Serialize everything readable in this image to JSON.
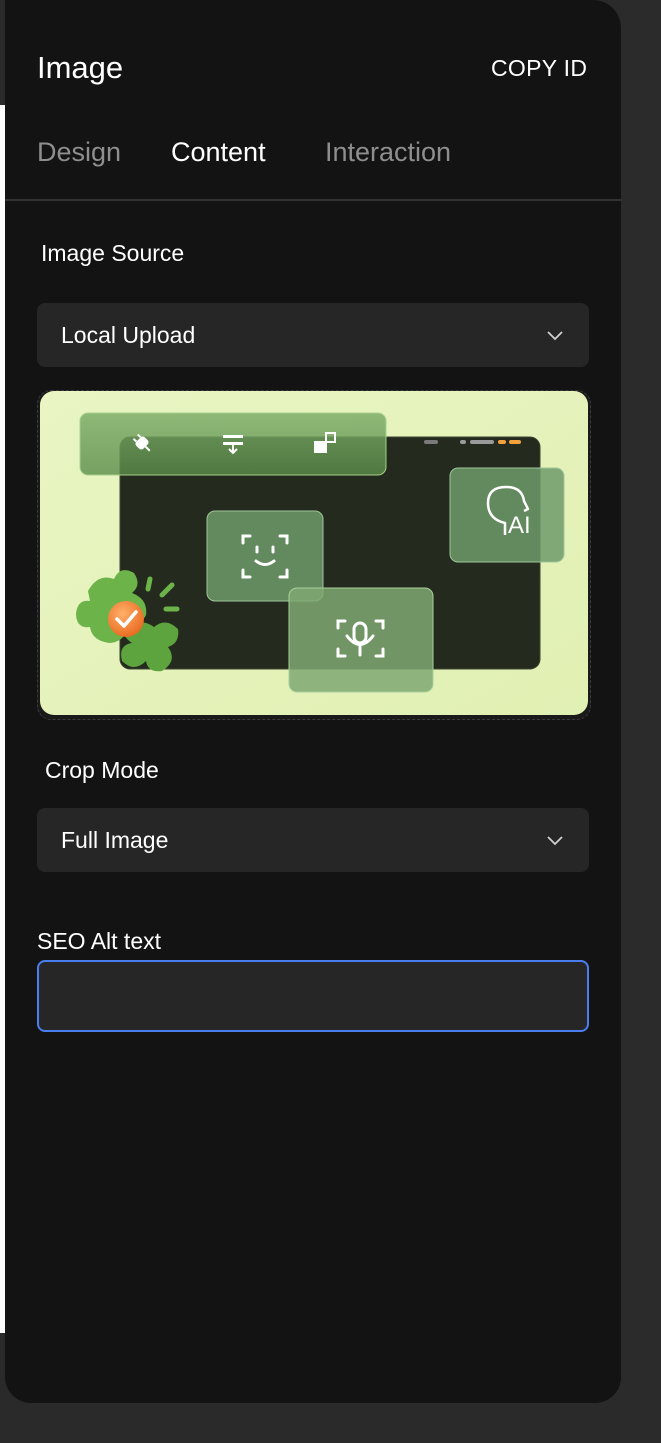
{
  "panel": {
    "title": "Image",
    "copy_id_label": "COPY ID"
  },
  "tabs": [
    {
      "label": "Design",
      "active": false
    },
    {
      "label": "Content",
      "active": true
    },
    {
      "label": "Interaction",
      "active": false
    }
  ],
  "image_source": {
    "label": "Image Source",
    "value": "Local Upload"
  },
  "crop_mode": {
    "label": "Crop Mode",
    "value": "Full Image"
  },
  "seo": {
    "label": "SEO Alt text",
    "value": "",
    "placeholder": ""
  },
  "preview_image_text": {
    "ai_badge": "AI"
  },
  "colors": {
    "panel_bg": "#131313",
    "field_bg": "#262626",
    "focus_border": "#4a7df0",
    "preview_bg": "#e6f3bd",
    "puzzle_green": "#6cb44a",
    "check_orange": "#f07a2a"
  }
}
